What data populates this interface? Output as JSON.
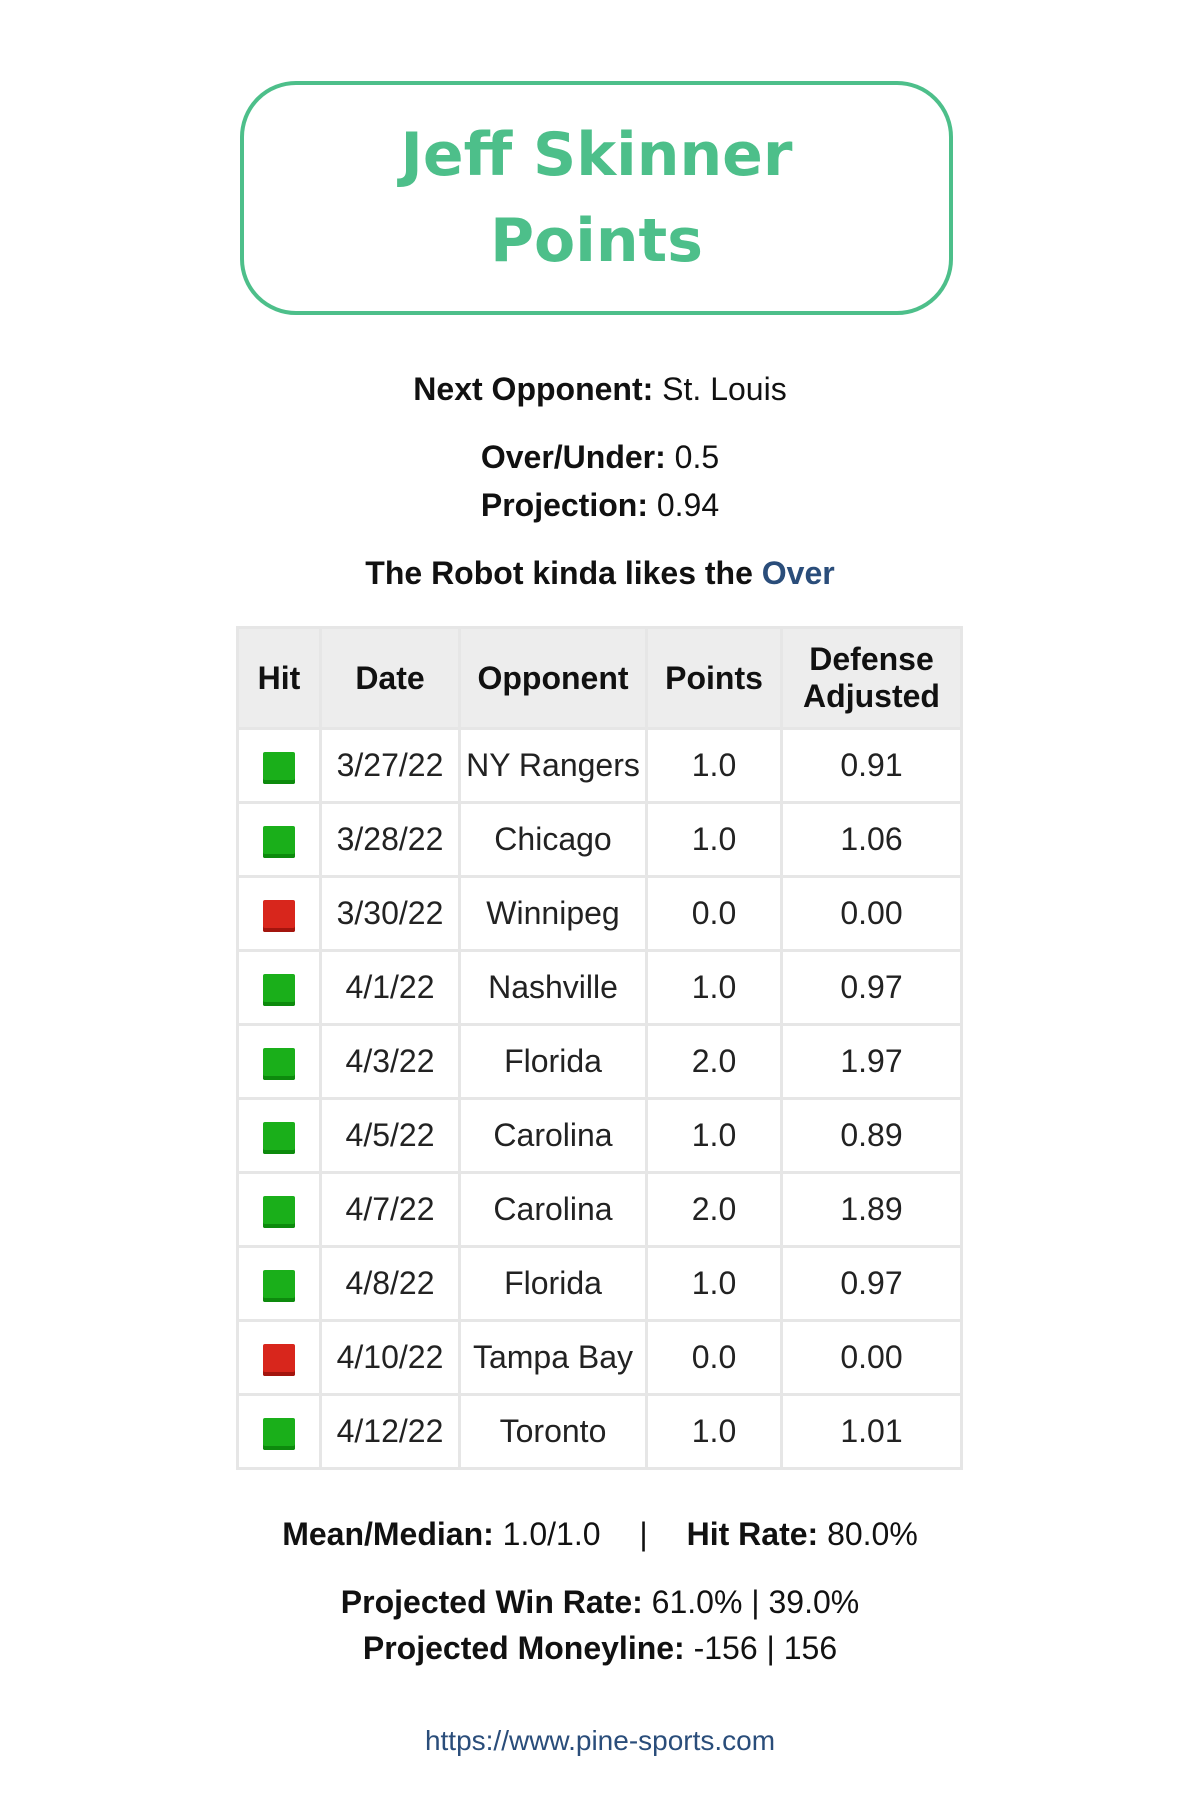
{
  "header": {
    "player": "Jeff Skinner",
    "market": "Points",
    "accent_color": "#4dbf8a"
  },
  "summary": {
    "next_opponent_label": "Next Opponent:",
    "next_opponent": "St. Louis",
    "over_under_label": "Over/Under:",
    "over_under": "0.5",
    "projection_label": "Projection:",
    "projection": "0.94",
    "verdict_prefix": "The Robot kinda likes the",
    "verdict_side": "Over",
    "verdict_color": "#2a4d7a"
  },
  "table": {
    "headers": [
      "Hit",
      "Date",
      "Opponent",
      "Points",
      "Defense Adjusted"
    ],
    "hit_color": "#1aaf1a",
    "miss_color": "#d8261c",
    "rows": [
      {
        "hit": true,
        "date": "3/27/22",
        "opponent": "NY Rangers",
        "points": "1.0",
        "adjusted": "0.91"
      },
      {
        "hit": true,
        "date": "3/28/22",
        "opponent": "Chicago",
        "points": "1.0",
        "adjusted": "1.06"
      },
      {
        "hit": false,
        "date": "3/30/22",
        "opponent": "Winnipeg",
        "points": "0.0",
        "adjusted": "0.00"
      },
      {
        "hit": true,
        "date": "4/1/22",
        "opponent": "Nashville",
        "points": "1.0",
        "adjusted": "0.97"
      },
      {
        "hit": true,
        "date": "4/3/22",
        "opponent": "Florida",
        "points": "2.0",
        "adjusted": "1.97"
      },
      {
        "hit": true,
        "date": "4/5/22",
        "opponent": "Carolina",
        "points": "1.0",
        "adjusted": "0.89"
      },
      {
        "hit": true,
        "date": "4/7/22",
        "opponent": "Carolina",
        "points": "2.0",
        "adjusted": "1.89"
      },
      {
        "hit": true,
        "date": "4/8/22",
        "opponent": "Florida",
        "points": "1.0",
        "adjusted": "0.97"
      },
      {
        "hit": false,
        "date": "4/10/22",
        "opponent": "Tampa Bay",
        "points": "0.0",
        "adjusted": "0.00"
      },
      {
        "hit": true,
        "date": "4/12/22",
        "opponent": "Toronto",
        "points": "1.0",
        "adjusted": "1.01"
      }
    ]
  },
  "stats": {
    "mean_median_label": "Mean/Median:",
    "mean_median": "1.0/1.0",
    "separator": "|",
    "hit_rate_label": "Hit Rate:",
    "hit_rate": "80.0%",
    "win_rate_label": "Projected Win Rate:",
    "win_rate": "61.0% | 39.0%",
    "moneyline_label": "Projected Moneyline:",
    "moneyline": "-156 | 156"
  },
  "footer": {
    "url": "https://www.pine-sports.com"
  }
}
